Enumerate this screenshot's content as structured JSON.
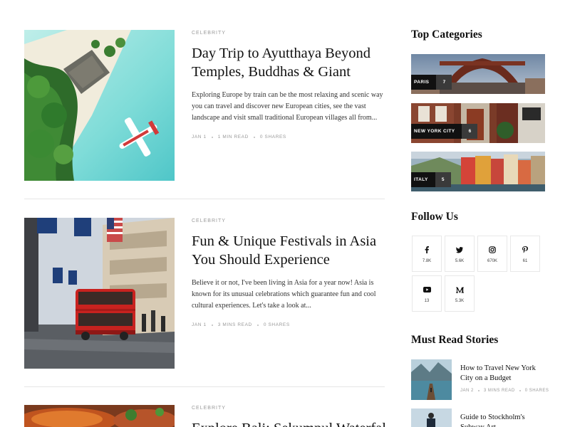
{
  "posts": [
    {
      "category": "Celebrity",
      "title": "Day Trip to Ayutthaya Beyond Temples, Buddhas & Giant",
      "excerpt": "Exploring Europe by train can be the most relaxing and scenic way you can travel and discover new European cities, see the vast landscape and visit small traditional European villages all from...",
      "date": "Jan 1",
      "read_time": "1 Min Read",
      "shares": "0 Shares"
    },
    {
      "category": "Celebrity",
      "title": "Fun & Unique Festivals in Asia You Should Experience",
      "excerpt": "Believe it or not, I've been living in Asia for a year now! Asia is known for its unusual celebrations which guarantee fun and cool cultural experiences. Let's take a look at...",
      "date": "Jan 1",
      "read_time": "3 Mins Read",
      "shares": "0 Shares"
    },
    {
      "category": "Celebrity",
      "title": "Explore Bali: Sekumpul Waterfall"
    }
  ],
  "sidebar": {
    "top_categories": {
      "heading": "Top Categories",
      "items": [
        {
          "name": "PARIS",
          "count": "7"
        },
        {
          "name": "NEW YORK CITY",
          "count": "6"
        },
        {
          "name": "ITALY",
          "count": "5"
        }
      ]
    },
    "follow_us": {
      "heading": "Follow Us",
      "items": [
        {
          "icon": "facebook-icon",
          "count": "7.8K"
        },
        {
          "icon": "twitter-icon",
          "count": "5.6K"
        },
        {
          "icon": "instagram-icon",
          "count": "670K"
        },
        {
          "icon": "pinterest-icon",
          "count": "61"
        },
        {
          "icon": "youtube-icon",
          "count": "13"
        },
        {
          "icon": "medium-icon",
          "count": "5.3K"
        }
      ]
    },
    "must_read": {
      "heading": "Must Read Stories",
      "items": [
        {
          "title": "How to Travel New York City on a Budget",
          "date": "JAN 2",
          "read_time": "3 MINS READ",
          "shares": "0 SHARES"
        },
        {
          "title": "Guide to Stockholm's Subway Art"
        }
      ]
    }
  }
}
